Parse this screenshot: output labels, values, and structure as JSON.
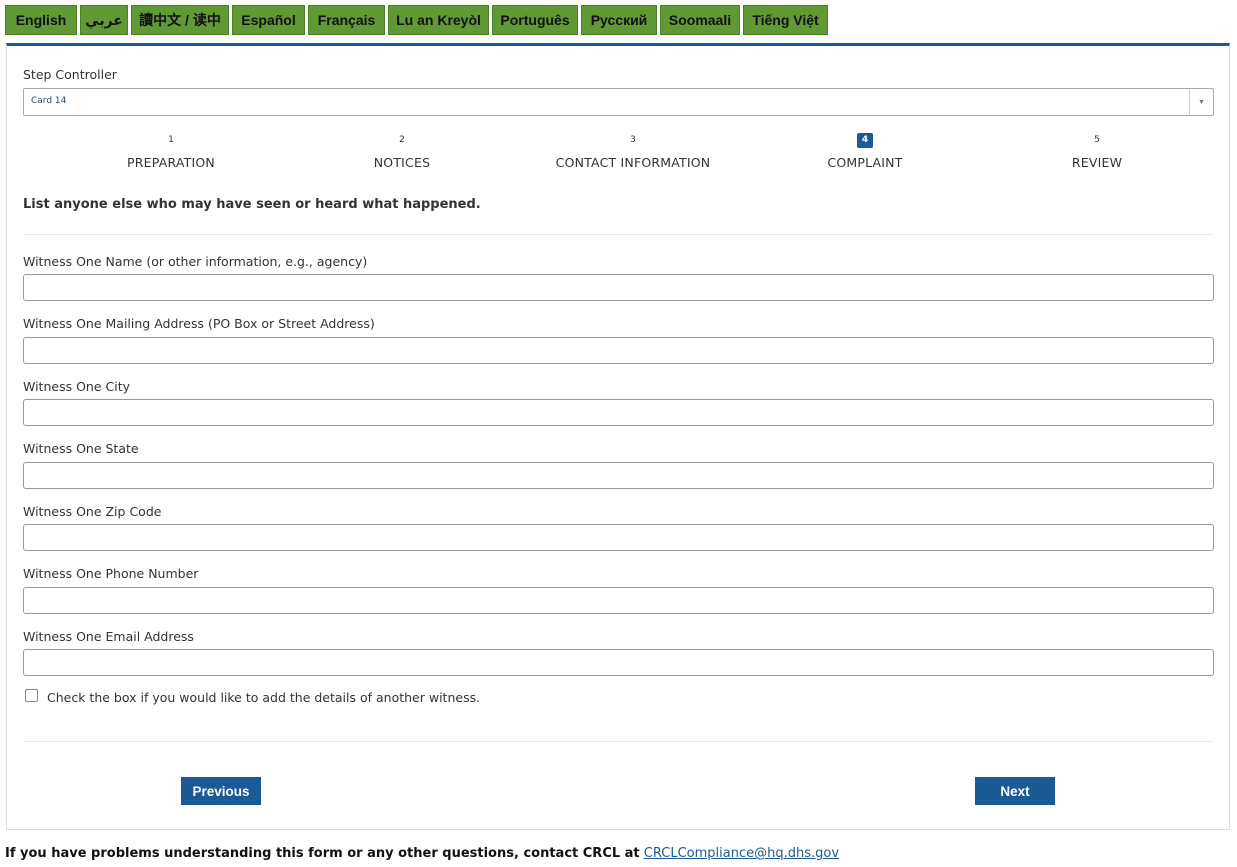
{
  "languages": [
    "English",
    "عربي",
    "讀中文 / 读中",
    "Español",
    "Français",
    "Lu an Kreyòl",
    "Português",
    "Русский",
    "Soomaali",
    "Tiếng Việt"
  ],
  "step_controller": {
    "label": "Step Controller",
    "selected": "Card 14",
    "arrow_icon": "chevron-down-icon"
  },
  "steps": [
    {
      "num": "1",
      "name": "PREPARATION",
      "active": false
    },
    {
      "num": "2",
      "name": "NOTICES",
      "active": false
    },
    {
      "num": "3",
      "name": "CONTACT INFORMATION",
      "active": false
    },
    {
      "num": "4",
      "name": "COMPLAINT",
      "active": true
    },
    {
      "num": "5",
      "name": "REVIEW",
      "active": false
    }
  ],
  "intro": "List anyone else who may have seen or heard what happened.",
  "fields": [
    {
      "label": "Witness One Name (or other information, e.g., agency)",
      "value": ""
    },
    {
      "label": "Witness One Mailing Address (PO Box or Street Address)",
      "value": ""
    },
    {
      "label": "Witness One City",
      "value": ""
    },
    {
      "label": "Witness One State",
      "value": ""
    },
    {
      "label": "Witness One Zip Code",
      "value": ""
    },
    {
      "label": "Witness One Phone Number",
      "value": ""
    },
    {
      "label": "Witness One Email Address",
      "value": ""
    }
  ],
  "add_witness_checkbox": {
    "label": "Check the box if you would like to add the details of another witness.",
    "checked": false
  },
  "buttons": {
    "previous": "Previous",
    "next": "Next"
  },
  "footer": {
    "text": "If you have problems understanding this form or any other questions, contact CRCL at",
    "link": "CRCLCompliance@hq.dhs.gov"
  },
  "colors": {
    "lang_green": "#5f9a35",
    "accent_blue": "#1b5a94"
  }
}
